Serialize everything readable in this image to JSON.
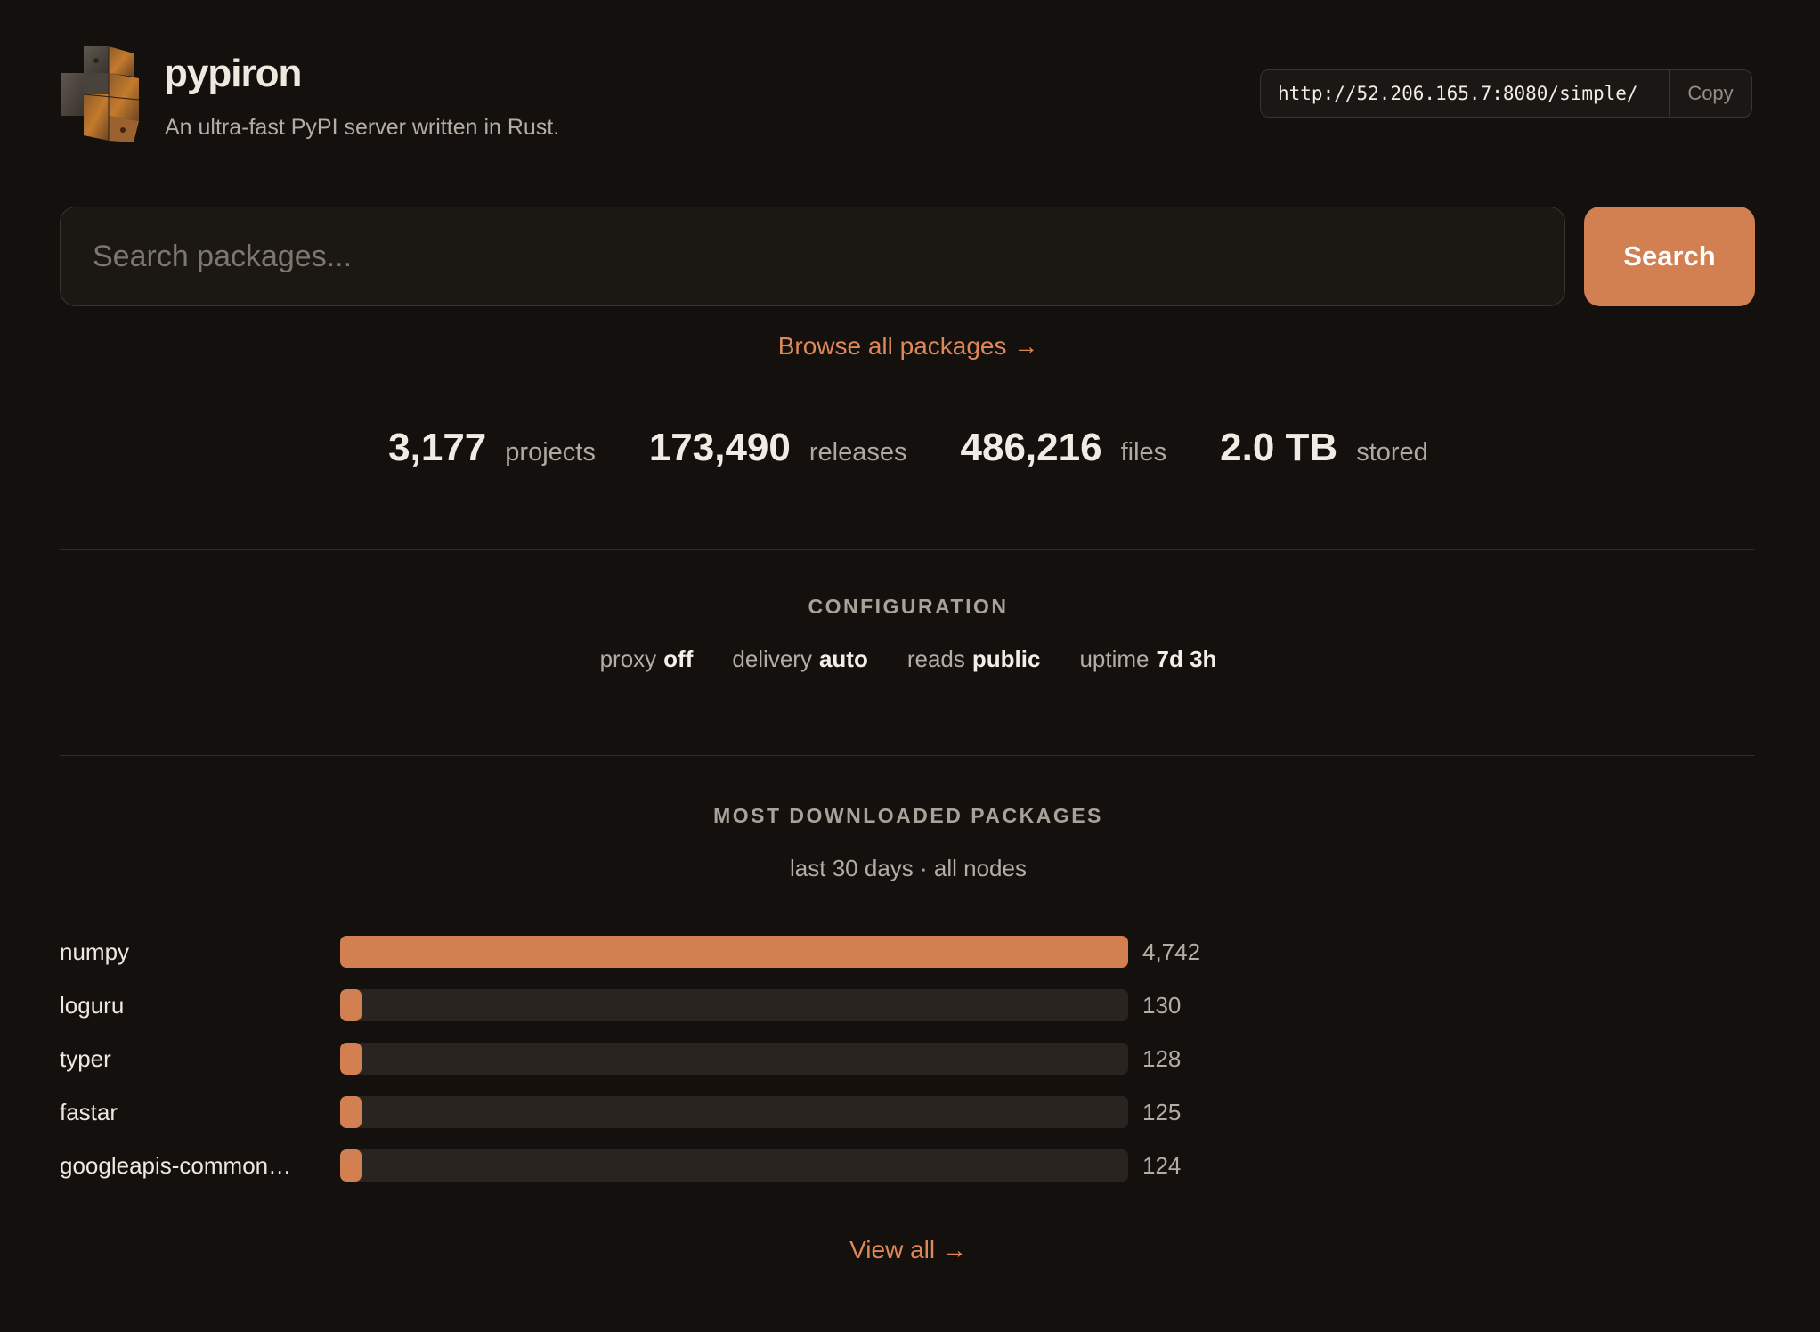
{
  "header": {
    "title": "pypiron",
    "tagline": "An ultra-fast PyPI server written in Rust.",
    "index_url": "http://52.206.165.7:8080/simple/",
    "copy_label": "Copy",
    "logo_icon": "python-logo-icon"
  },
  "search": {
    "placeholder": "Search packages...",
    "value": "",
    "button_label": "Search"
  },
  "browse_link": "Browse all packages →",
  "stats": [
    {
      "value": "3,177",
      "label": "projects"
    },
    {
      "value": "173,490",
      "label": "releases"
    },
    {
      "value": "486,216",
      "label": "files"
    },
    {
      "value": "2.0 TB",
      "label": "stored"
    }
  ],
  "configuration": {
    "title": "CONFIGURATION",
    "items": [
      {
        "key": "proxy",
        "value": "off"
      },
      {
        "key": "delivery",
        "value": "auto"
      },
      {
        "key": "reads",
        "value": "public"
      },
      {
        "key": "uptime",
        "value": "7d 3h"
      }
    ]
  },
  "downloads": {
    "title": "MOST DOWNLOADED PACKAGES",
    "subtitle": "last 30 days · all nodes",
    "view_all": "View all →"
  },
  "chart_data": {
    "type": "bar",
    "categories": [
      "numpy",
      "loguru",
      "typer",
      "fastar",
      "googleapis-common…"
    ],
    "values": [
      4742,
      130,
      128,
      125,
      124
    ],
    "value_labels": [
      "4,742",
      "130",
      "128",
      "125",
      "124"
    ],
    "title": "MOST DOWNLOADED PACKAGES",
    "subtitle": "last 30 days · all nodes",
    "orientation": "horizontal"
  },
  "colors": {
    "accent": "#d27f51",
    "background": "#13100e",
    "track": "#2a2420"
  }
}
